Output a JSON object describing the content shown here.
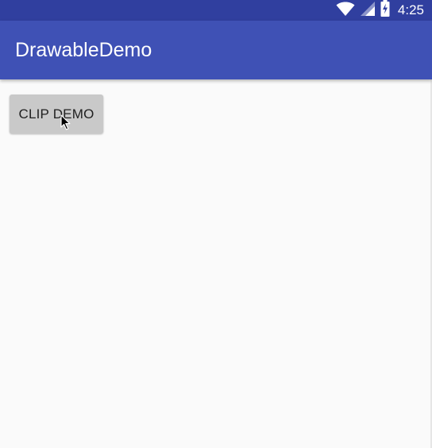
{
  "status_bar": {
    "time": "4:25",
    "icons": [
      "wifi-icon",
      "signal-icon",
      "battery-charging-icon"
    ]
  },
  "app_bar": {
    "title": "DrawableDemo"
  },
  "content": {
    "clip_demo_button_label": "CLIP DEMO"
  },
  "colors": {
    "status_bar": "#303f9f",
    "app_bar": "#3f51b5",
    "background": "#fafafa",
    "button": "#c9c9c9"
  }
}
